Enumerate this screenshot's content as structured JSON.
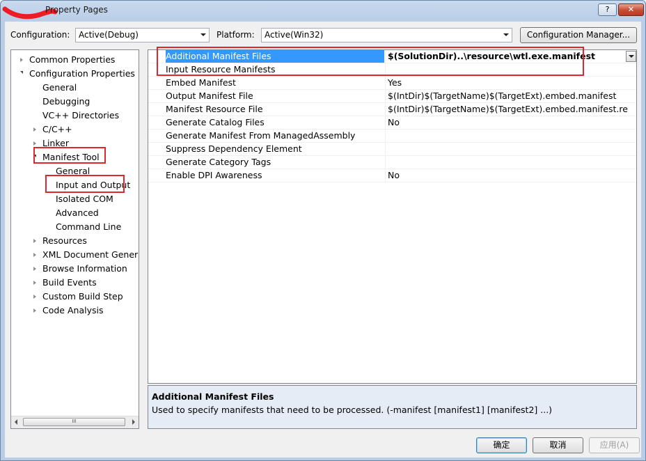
{
  "window": {
    "title": "Property Pages",
    "help_glyph": "?",
    "close_glyph": "✕"
  },
  "toolbar": {
    "configuration_label": "Configuration:",
    "configuration_value": "Active(Debug)",
    "platform_label": "Platform:",
    "platform_value": "Active(Win32)",
    "config_manager_label": "Configuration Manager..."
  },
  "tree": {
    "items": [
      {
        "label": "Common Properties",
        "toggle": "closed"
      },
      {
        "label": "Configuration Properties",
        "toggle": "open"
      },
      {
        "label": "General",
        "toggle": "none"
      },
      {
        "label": "Debugging",
        "toggle": "none"
      },
      {
        "label": "VC++ Directories",
        "toggle": "none"
      },
      {
        "label": "C/C++",
        "toggle": "closed"
      },
      {
        "label": "Linker",
        "toggle": "closed"
      },
      {
        "label": "Manifest Tool",
        "toggle": "open"
      },
      {
        "label": "General",
        "toggle": "none"
      },
      {
        "label": "Input and Output",
        "toggle": "none"
      },
      {
        "label": "Isolated COM",
        "toggle": "none"
      },
      {
        "label": "Advanced",
        "toggle": "none"
      },
      {
        "label": "Command Line",
        "toggle": "none"
      },
      {
        "label": "Resources",
        "toggle": "closed"
      },
      {
        "label": "XML Document Generator",
        "toggle": "closed"
      },
      {
        "label": "Browse Information",
        "toggle": "closed"
      },
      {
        "label": "Build Events",
        "toggle": "closed"
      },
      {
        "label": "Custom Build Step",
        "toggle": "closed"
      },
      {
        "label": "Code Analysis",
        "toggle": "closed"
      }
    ],
    "scroll_grip": "III"
  },
  "grid": {
    "rows": [
      {
        "name": "Additional Manifest Files",
        "value": "$(SolutionDir)..\\resource\\wtl.exe.manifest"
      },
      {
        "name": "Input Resource Manifests",
        "value": ""
      },
      {
        "name": "Embed Manifest",
        "value": "Yes"
      },
      {
        "name": "Output Manifest File",
        "value": "$(IntDir)$(TargetName)$(TargetExt).embed.manifest"
      },
      {
        "name": "Manifest Resource File",
        "value": "$(IntDir)$(TargetName)$(TargetExt).embed.manifest.res"
      },
      {
        "name": "Generate Catalog Files",
        "value": "No"
      },
      {
        "name": "Generate Manifest From ManagedAssembly",
        "value": ""
      },
      {
        "name": "Suppress Dependency Element",
        "value": ""
      },
      {
        "name": "Generate Category Tags",
        "value": ""
      },
      {
        "name": "Enable DPI Awareness",
        "value": "No"
      }
    ]
  },
  "description": {
    "title": "Additional Manifest Files",
    "text": "Used to specify manifests that need to be processed. (-manifest [manifest1] [manifest2] ...)"
  },
  "buttons": {
    "ok": "确定",
    "cancel": "取消",
    "apply": "应用(A)"
  },
  "colors": {
    "selection": "#3399ff",
    "highlight_box": "#e0262a"
  }
}
